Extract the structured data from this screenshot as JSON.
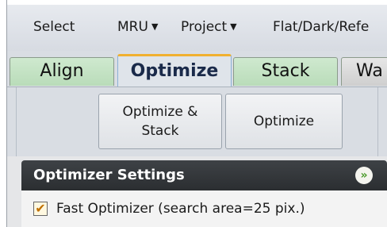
{
  "menu": {
    "select": "Select",
    "mru": "MRU",
    "project": "Project",
    "flat_dark": "Flat/Dark/Refe"
  },
  "tabs": [
    {
      "label": "Align"
    },
    {
      "label": "Optimize"
    },
    {
      "label": "Stack"
    },
    {
      "label": "Wa"
    }
  ],
  "toolbar": {
    "optimize_stack_line1": "Optimize &",
    "optimize_stack_line2": "Stack",
    "optimize": "Optimize"
  },
  "settings": {
    "title": "Optimizer Settings",
    "fast_optimizer": {
      "label": "Fast Optimizer (search area=25 pix.)",
      "checked": true
    }
  },
  "colors": {
    "active_tab_accent": "#f0b030",
    "inactive_tab": "#c4e2c4",
    "header_bg": "#34383c",
    "collapse_icon": "#4a9a2a"
  }
}
